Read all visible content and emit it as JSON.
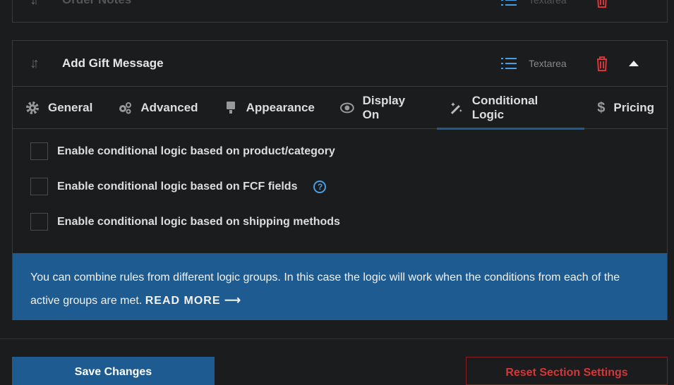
{
  "fields": [
    {
      "title": "Order Notes",
      "type": "Textarea"
    },
    {
      "title": "Add Gift Message",
      "type": "Textarea"
    }
  ],
  "tabs": [
    {
      "label": "General",
      "icon": "gear-icon"
    },
    {
      "label": "Advanced",
      "icon": "gears-icon"
    },
    {
      "label": "Appearance",
      "icon": "brush-icon"
    },
    {
      "label": "Display On",
      "icon": "eye-icon"
    },
    {
      "label": "Conditional Logic",
      "icon": "magic-wand-icon",
      "active": true
    },
    {
      "label": "Pricing",
      "icon": "dollar-icon"
    }
  ],
  "options": [
    {
      "label": "Enable conditional logic based on product/category",
      "checked": false
    },
    {
      "label": "Enable conditional logic based on FCF fields",
      "checked": false,
      "help": "?"
    },
    {
      "label": "Enable conditional logic based on shipping methods",
      "checked": false
    }
  ],
  "info": {
    "text": "You can combine rules from different logic groups. In this case the logic will work when the conditions from each of the active groups are met.",
    "link": "READ MORE ⟶"
  },
  "buttons": {
    "save": "Save Changes",
    "reset": "Reset Section Settings"
  },
  "colors": {
    "accent": "#1d5b91",
    "danger": "#d63638",
    "bg": "#1b1c1e"
  }
}
